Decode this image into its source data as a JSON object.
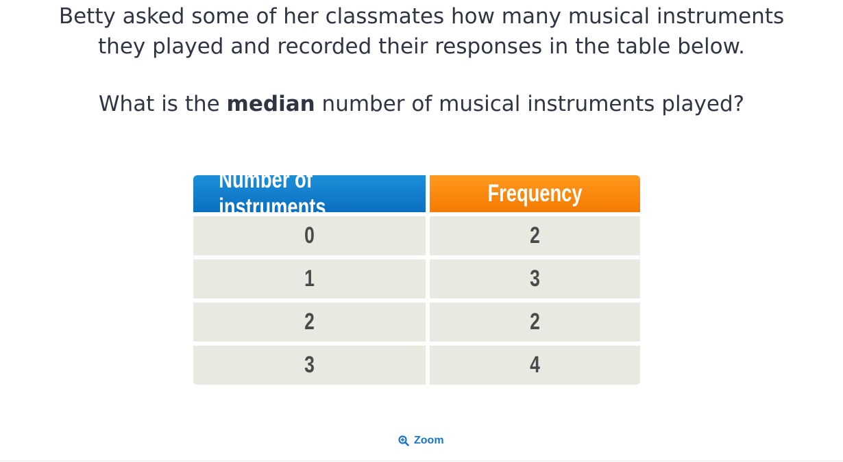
{
  "question": {
    "line1": "Betty asked some of her classmates how many musical instruments",
    "line2": "they played and recorded their responses in the table below.",
    "prompt_before": "What is the ",
    "prompt_bold": "median",
    "prompt_after": " number of musical instruments played?"
  },
  "table": {
    "headers": [
      "Number of instruments",
      "Frequency"
    ],
    "rows": [
      [
        "0",
        "2"
      ],
      [
        "1",
        "3"
      ],
      [
        "2",
        "2"
      ],
      [
        "3",
        "4"
      ]
    ]
  },
  "zoom": {
    "label": "Zoom",
    "icon": "zoom-in-icon"
  },
  "colors": {
    "header1": "#0a6fc0",
    "header2": "#f47b00",
    "cell_bg": "#e9e8e1",
    "text": "#2f3542",
    "link": "#1a73c8"
  }
}
